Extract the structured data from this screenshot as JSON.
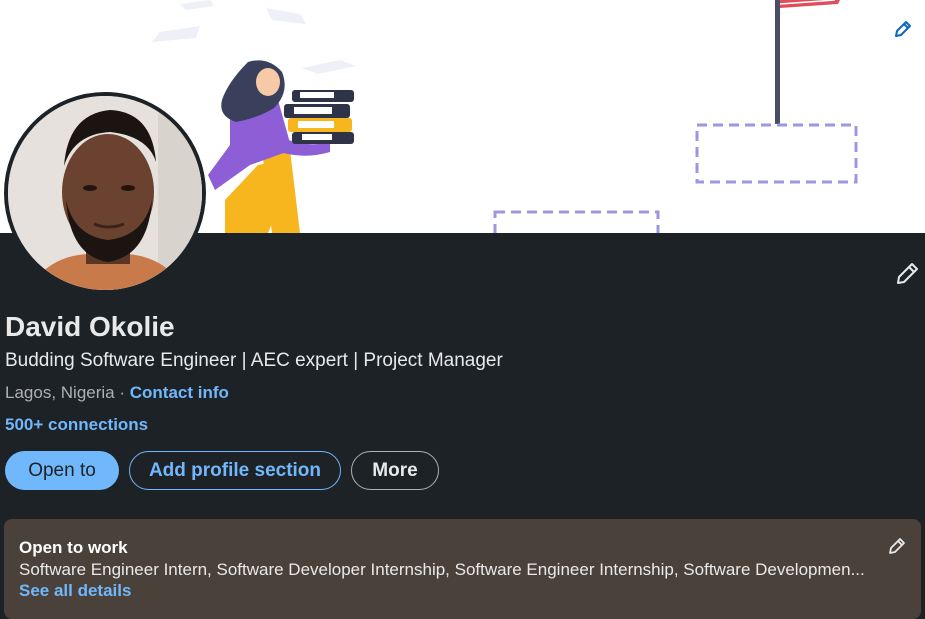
{
  "profile": {
    "name": "David Okolie",
    "headline": "Budding Software Engineer | AEC expert | Project Manager",
    "location": "Lagos, Nigeria",
    "separator": "·",
    "contact_info": "Contact info",
    "connections": "500+ connections"
  },
  "actions": {
    "open_to": "Open to",
    "add_profile_section": "Add profile section",
    "more": "More"
  },
  "open_to_work": {
    "title": "Open to work",
    "roles": "Software Engineer Intern, Software Developer Internship, Software Engineer Internship, Software Developmen...",
    "see_details": "See all details"
  },
  "icons": {
    "banner_edit": "pencil-icon",
    "intro_edit": "pencil-icon",
    "card_edit": "pencil-icon"
  },
  "colors": {
    "page_bg": "#1d2226",
    "accent": "#71b7fb",
    "card_bg": "#4a413a",
    "banner_bg": "#ffffff"
  }
}
